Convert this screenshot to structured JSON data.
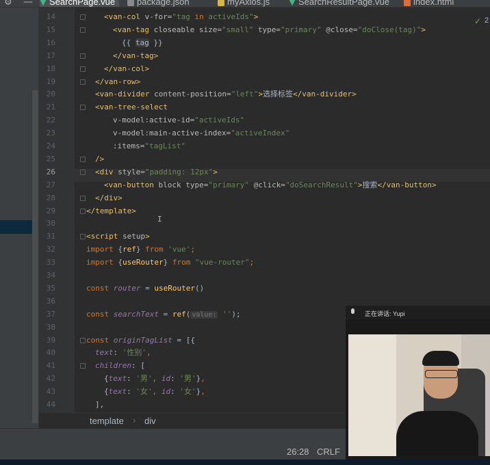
{
  "tabs": [
    {
      "label": "SearchPage.vue",
      "active": true,
      "icon": "vue-file-icon"
    },
    {
      "label": "package.json",
      "active": false,
      "icon": "json-file-icon"
    },
    {
      "label": "myAxios.js",
      "active": false,
      "icon": "js-file-icon"
    },
    {
      "label": "SearchResultPage.vue",
      "active": false,
      "icon": "vue-file-icon"
    },
    {
      "label": "index.html",
      "active": false,
      "icon": "html-file-icon"
    }
  ],
  "editor": {
    "inspection_count": "2",
    "lines": [
      {
        "n": "14",
        "segs": [
          [
            "tg",
            "<van-col "
          ],
          [
            "at",
            "v-for="
          ],
          [
            "sv",
            "\"tag "
          ],
          [
            "kw",
            "in"
          ],
          [
            "sv",
            " activeIds\""
          ],
          [
            "tg",
            ">"
          ]
        ]
      },
      {
        "n": "15",
        "segs": [
          [
            "tg",
            "<van-tag "
          ],
          [
            "at",
            "closeable size="
          ],
          [
            "sv",
            "\"small\""
          ],
          [
            "at",
            " type="
          ],
          [
            "sv",
            "\"primary\""
          ],
          [
            "at",
            " @close="
          ],
          [
            "sv",
            "\"doClose(tag)\""
          ],
          [
            "tg",
            ">"
          ]
        ]
      },
      {
        "n": "16",
        "segs": [
          [
            "tx",
            "{{ "
          ],
          [
            "hl",
            "tag"
          ],
          [
            "tx",
            " }}"
          ]
        ]
      },
      {
        "n": "17",
        "segs": [
          [
            "tg",
            "</van-tag>"
          ]
        ]
      },
      {
        "n": "18",
        "segs": [
          [
            "tg",
            "</van-col>"
          ]
        ]
      },
      {
        "n": "19",
        "segs": [
          [
            "tg",
            "</van-row>"
          ]
        ]
      },
      {
        "n": "20",
        "segs": [
          [
            "tg",
            "<van-divider "
          ],
          [
            "at",
            "content-position="
          ],
          [
            "sv",
            "\"left\""
          ],
          [
            "tg",
            ">"
          ],
          [
            "tx",
            "选择标签"
          ],
          [
            "tg",
            "</van-divider>"
          ]
        ]
      },
      {
        "n": "21",
        "segs": [
          [
            "tg",
            "<van-tree-select"
          ]
        ]
      },
      {
        "n": "22",
        "segs": [
          [
            "at",
            "v-model:active-id="
          ],
          [
            "sv",
            "\"activeIds\""
          ]
        ]
      },
      {
        "n": "23",
        "segs": [
          [
            "at",
            "v-model:main-active-index="
          ],
          [
            "sv",
            "\"activeIndex\""
          ]
        ]
      },
      {
        "n": "24",
        "segs": [
          [
            "at",
            ":items="
          ],
          [
            "sv",
            "\"tagList\""
          ]
        ]
      },
      {
        "n": "25",
        "segs": [
          [
            "tg",
            "/>"
          ]
        ]
      },
      {
        "n": "26",
        "segs": [
          [
            "tg",
            "<div "
          ],
          [
            "at",
            "style="
          ],
          [
            "sv",
            "\"padding: 12px\""
          ],
          [
            "tg",
            ">"
          ]
        ]
      },
      {
        "n": "27",
        "segs": [
          [
            "tg",
            "<van-button "
          ],
          [
            "at",
            "block type="
          ],
          [
            "sv",
            "\"primary\""
          ],
          [
            "at",
            " @click="
          ],
          [
            "sv",
            "\"doSearchResult\""
          ],
          [
            "tg",
            ">"
          ],
          [
            "tx",
            "搜索"
          ],
          [
            "tg",
            "</van-button>"
          ]
        ]
      },
      {
        "n": "28",
        "segs": [
          [
            "tg",
            "</div>"
          ]
        ]
      },
      {
        "n": "29",
        "segs": [
          [
            "tg",
            "</template>"
          ]
        ]
      },
      {
        "n": "30",
        "segs": []
      },
      {
        "n": "31",
        "segs": [
          [
            "tg",
            "<script "
          ],
          [
            "at",
            "setup"
          ],
          [
            "tg",
            ">"
          ]
        ]
      },
      {
        "n": "32",
        "segs": [
          [
            "kw",
            "import "
          ],
          [
            "pl",
            "{"
          ],
          [
            "fn",
            "ref"
          ],
          [
            "pl",
            "} "
          ],
          [
            "kw",
            "from "
          ],
          [
            "sv",
            "'vue'"
          ],
          [
            "kw",
            ";"
          ]
        ]
      },
      {
        "n": "33",
        "segs": [
          [
            "kw",
            "import "
          ],
          [
            "pl",
            "{"
          ],
          [
            "fn",
            "useRouter"
          ],
          [
            "pl",
            "} "
          ],
          [
            "kw",
            "from "
          ],
          [
            "sv",
            "\"vue-router\""
          ],
          [
            "kw",
            ";"
          ]
        ]
      },
      {
        "n": "34",
        "segs": []
      },
      {
        "n": "35",
        "segs": [
          [
            "kw",
            "const "
          ],
          [
            "vr",
            "router"
          ],
          [
            "pl",
            " = "
          ],
          [
            "fn",
            "useRouter"
          ],
          [
            "pl",
            "()"
          ]
        ]
      },
      {
        "n": "36",
        "segs": []
      },
      {
        "n": "37",
        "segs": [
          [
            "kw",
            "const "
          ],
          [
            "vr",
            "searchText"
          ],
          [
            "pl",
            " = "
          ],
          [
            "fn",
            "ref"
          ],
          [
            "pl",
            "("
          ],
          [
            "hint",
            "value:"
          ],
          [
            "sv",
            " ''"
          ],
          [
            "pl",
            ");"
          ]
        ]
      },
      {
        "n": "38",
        "segs": []
      },
      {
        "n": "39",
        "segs": [
          [
            "kw",
            "const "
          ],
          [
            "vr",
            "originTagList"
          ],
          [
            "pl",
            " = [{"
          ]
        ]
      },
      {
        "n": "40",
        "segs": [
          [
            "vr",
            "text"
          ],
          [
            "pl",
            ": "
          ],
          [
            "sv",
            "'性别'"
          ],
          [
            "kw",
            ","
          ]
        ]
      },
      {
        "n": "41",
        "segs": [
          [
            "vr",
            "children"
          ],
          [
            "pl",
            ": ["
          ]
        ]
      },
      {
        "n": "42",
        "segs": [
          [
            "pl",
            "{"
          ],
          [
            "vr",
            "text"
          ],
          [
            "pl",
            ": "
          ],
          [
            "sv",
            "'男'"
          ],
          [
            "kw",
            ", "
          ],
          [
            "vr",
            "id"
          ],
          [
            "pl",
            ": "
          ],
          [
            "sv",
            "'男'"
          ],
          [
            "pl",
            "}"
          ],
          [
            "kw",
            ","
          ]
        ]
      },
      {
        "n": "43",
        "segs": [
          [
            "pl",
            "{"
          ],
          [
            "vr",
            "text"
          ],
          [
            "pl",
            ": "
          ],
          [
            "sv",
            "'女'"
          ],
          [
            "kw",
            ", "
          ],
          [
            "vr",
            "id"
          ],
          [
            "pl",
            ": "
          ],
          [
            "sv",
            "'女'"
          ],
          [
            "pl",
            "}"
          ],
          [
            "kw",
            ","
          ]
        ]
      },
      {
        "n": "44",
        "segs": [
          [
            "pl",
            "],"
          ]
        ]
      }
    ]
  },
  "breadcrumb": {
    "items": [
      "template",
      "div"
    ],
    "separator": "›"
  },
  "status": {
    "position": "26:28",
    "line_ending": "CRLF"
  },
  "video": {
    "label": "正在讲话: Yupi"
  },
  "colors": {
    "accent": "#4a88c7",
    "tag": "#e8bf6a",
    "string": "#6a8759",
    "keyword": "#cc7832"
  }
}
